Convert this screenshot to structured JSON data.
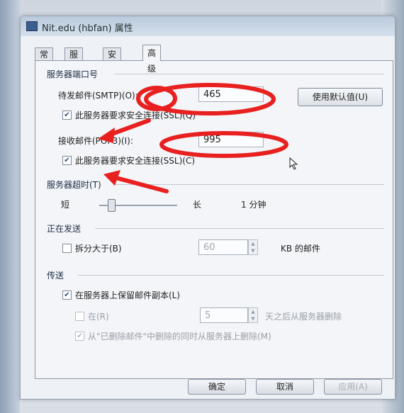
{
  "window": {
    "title": "Nit.edu (hbfan) 属性"
  },
  "tabs": [
    {
      "label": "常规"
    },
    {
      "label": "服务器"
    },
    {
      "label": "安全"
    },
    {
      "label": "高级"
    }
  ],
  "server_ports": {
    "group_label": "服务器端口号",
    "smtp_label": "待发邮件(SMTP)(O):",
    "smtp_value": "465",
    "default_button": "使用默认值(U)",
    "smtp_ssl_label": "此服务器要求安全连接(SSL)(Q)",
    "smtp_ssl_checked": true,
    "pop3_label": "接收邮件(POP3)(I):",
    "pop3_value": "995",
    "pop3_ssl_label": "此服务器要求安全连接(SSL)(C)",
    "pop3_ssl_checked": true
  },
  "timeout": {
    "group_label": "服务器超时(T)",
    "short_label": "短",
    "long_label": "长",
    "value_label": "1 分钟",
    "level": 0.15
  },
  "sending": {
    "group_label": "正在发送",
    "split_label": "拆分大于(B)",
    "split_checked": false,
    "split_value": "60",
    "split_unit": "KB 的邮件"
  },
  "delivery": {
    "group_label": "传送",
    "keep_copy_label": "在服务器上保留邮件副本(L)",
    "keep_copy_checked": true,
    "remove_after_label": "在(R)",
    "remove_after_checked": false,
    "remove_after_value": "5",
    "remove_after_suffix": "天之后从服务器删除",
    "remove_deleted_label": "从\"已删除邮件\"中删除的同时从服务器上删除(M)",
    "remove_deleted_checked": true
  },
  "buttons": {
    "ok": "确定",
    "cancel": "取消",
    "apply": "应用(A)"
  },
  "colors": {
    "annotation_red": "#e8201f",
    "dialog_bg": "#f3f5f8",
    "accent": "#3a5f8e"
  }
}
